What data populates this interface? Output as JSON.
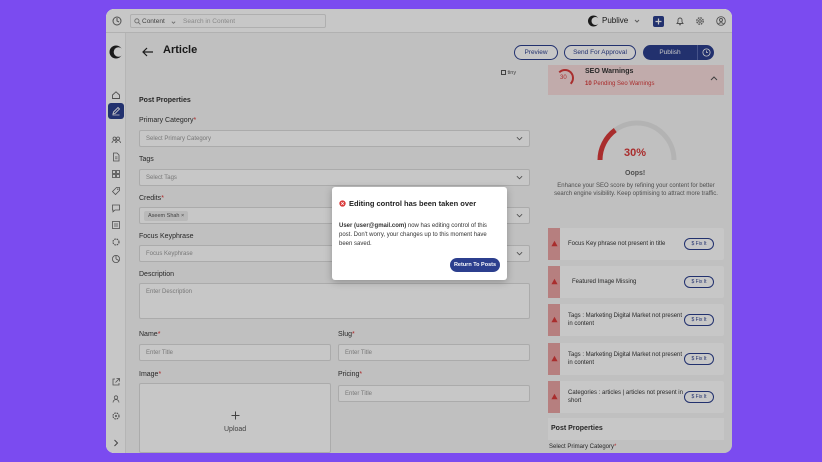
{
  "topbar": {
    "search_scope": "Content",
    "search_placeholder": "Search in Content",
    "brand": "Publive"
  },
  "header": {
    "title": "Article",
    "preview_label": "Preview",
    "send_label": "Send For Approval",
    "publish_label": "Publish",
    "tiny_label": "tiny"
  },
  "form": {
    "section_title": "Post Properties",
    "primary_category_label": "Primary Category",
    "primary_category_placeholder": "Select Primary Category",
    "tags_label": "Tags",
    "tags_placeholder": "Select Tags",
    "credits_label": "Credits",
    "credits_chip": "Aseem Shah",
    "focus_label": "Focus Keyphrase",
    "focus_placeholder": "Focus Keyphrase",
    "description_label": "Description",
    "description_placeholder": "Enter Description",
    "name_label": "Name",
    "name_placeholder": "Enter Title",
    "slug_label": "Slug",
    "slug_placeholder": "Enter Title",
    "image_label": "Image",
    "upload_label": "Upload",
    "pricing_label": "Pricing",
    "pricing_placeholder": "Enter Title",
    "required_mark": "*"
  },
  "seo": {
    "score_badge": "30",
    "warnings_title": "SEO Warnings",
    "pending_count": "10",
    "pending_text": "Pending Seo Warnings",
    "gauge_value": "30%",
    "gauge_fraction": 0.3,
    "oops": "Oops!",
    "advice": "Enhance your SEO score by refining your content for better search engine visibility. Keep optimising to attract more traffic.",
    "fix_label": "Fix It",
    "warnings": [
      "Focus Key phrase not present in title",
      "Featured Image Missing",
      "Tags : Marketing Digital Market not present in content",
      "Tags : Marketing Digital Market not present in content",
      "Categories : articles | articles not present in short"
    ],
    "post_properties_title": "Post Properties",
    "select_primary_label": "Select Primary Category"
  },
  "modal": {
    "title": "Editing control has been taken over",
    "user": "User (user@gmail.com)",
    "message": " now has editing control of this post. Don't worry, your changes up to this moment have been saved.",
    "button": "Return To Posts"
  },
  "colors": {
    "accent": "#2c3f8e",
    "danger": "#d93a3a",
    "background": "#7b4bf0"
  }
}
